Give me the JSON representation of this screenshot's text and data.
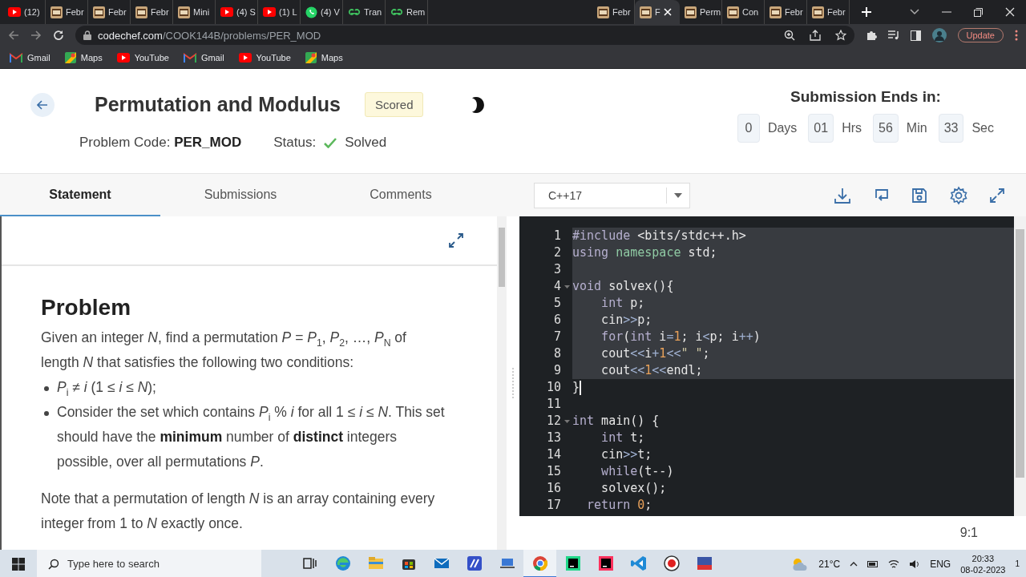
{
  "browser": {
    "tabs": [
      {
        "kind": "youtube",
        "title": "(12)",
        "selected": false
      },
      {
        "kind": "codechef",
        "title": "Febr",
        "selected": false
      },
      {
        "kind": "codechef",
        "title": "Febr",
        "selected": false
      },
      {
        "kind": "codechef",
        "title": "Febr",
        "selected": false
      },
      {
        "kind": "codechef",
        "title": "Mini",
        "selected": false
      },
      {
        "kind": "youtube",
        "title": "(4) S",
        "selected": false
      },
      {
        "kind": "youtube",
        "title": "(1) L",
        "selected": false
      },
      {
        "kind": "whatsapp",
        "title": "(4) V",
        "selected": false
      },
      {
        "kind": "gfg",
        "title": "Tran",
        "selected": false
      },
      {
        "kind": "gfg",
        "title": "Rem",
        "selected": false
      },
      {
        "kind": "codechef",
        "title": "Febr",
        "selected": false
      },
      {
        "kind": "codechef",
        "title": "F",
        "selected": true
      },
      {
        "kind": "codechef",
        "title": "Perm",
        "selected": false
      },
      {
        "kind": "codechef",
        "title": "Con",
        "selected": false
      },
      {
        "kind": "codechef",
        "title": "Febr",
        "selected": false
      },
      {
        "kind": "codechef",
        "title": "Febr",
        "selected": false
      }
    ],
    "url_host": "codechef.com",
    "url_path": "/COOK144B/problems/PER_MOD",
    "update_label": "Update",
    "bookmarks": [
      {
        "kind": "gmail",
        "label": "Gmail"
      },
      {
        "kind": "maps",
        "label": "Maps"
      },
      {
        "kind": "youtube",
        "label": "YouTube"
      },
      {
        "kind": "gmail",
        "label": "Gmail"
      },
      {
        "kind": "youtube",
        "label": "YouTube"
      },
      {
        "kind": "maps",
        "label": "Maps"
      }
    ]
  },
  "problem": {
    "title": "Permutation and Modulus",
    "badge": "Scored",
    "code_label": "Problem Code:",
    "code": "PER_MOD",
    "status_label": "Status:",
    "status": "Solved",
    "solved": true
  },
  "countdown": {
    "title": "Submission Ends in:",
    "units": [
      {
        "value": "0",
        "unit": "Days"
      },
      {
        "value": "01",
        "unit": "Hrs"
      },
      {
        "value": "56",
        "unit": "Min"
      },
      {
        "value": "33",
        "unit": "Sec"
      }
    ]
  },
  "tabs": [
    {
      "label": "Statement",
      "selected": true
    },
    {
      "label": "Submissions",
      "selected": false
    },
    {
      "label": "Comments",
      "selected": false
    }
  ],
  "language": "C++17",
  "statement": {
    "heading": "Problem",
    "blocks": [
      {
        "kind": "para",
        "text": "Given an integer *N*, find a permutation *P* = *P*$_{1}$, *P*$_{2}$, …, *P*$_{N}$ of length *N* that satisfies the following two conditions:"
      },
      {
        "kind": "bullet",
        "text": "*P*$_{i}$ ≠ *i* (1 ≤ *i* ≤ *N*);"
      },
      {
        "kind": "bullet",
        "text": "Consider the set which contains *P*$_{i}$ % *i* for all 1 ≤ *i* ≤ *N*. This set should have the **minimum** number of **distinct** integers possible, over all permutations *P*."
      },
      {
        "kind": "para",
        "text": "Note that a permutation of length *N* is an array containing every integer from 1 to *N* exactly once."
      }
    ]
  },
  "editor": {
    "position": "9:1",
    "lines": [
      {
        "number": "1",
        "kind": "top",
        "selected": true,
        "fold": false,
        "cursor": false,
        "tokens": [
          {
            "kind": "kw",
            "text": "#include"
          },
          {
            "kind": "plain",
            "text": " <bits/stdc++.h>"
          }
        ]
      },
      {
        "number": "2",
        "kind": "top",
        "selected": true,
        "fold": false,
        "cursor": false,
        "tokens": [
          {
            "kind": "kw",
            "text": "using"
          },
          {
            "kind": "ns",
            "text": " namespace"
          },
          {
            "kind": "plain",
            "text": " std;"
          }
        ]
      },
      {
        "number": "3",
        "kind": "top",
        "selected": true,
        "fold": false,
        "cursor": false
      },
      {
        "number": "4",
        "kind": "top",
        "selected": true,
        "fold": true,
        "cursor": false,
        "tokens": [
          {
            "kind": "kw",
            "text": "void"
          },
          {
            "kind": "plain",
            "text": " solvex(){"
          }
        ]
      },
      {
        "number": "5",
        "kind": "block",
        "selected": true,
        "fold": false,
        "cursor": false,
        "tokens": [
          {
            "kind": "kw",
            "text": "int"
          },
          {
            "kind": "plain",
            "text": " p;"
          }
        ]
      },
      {
        "number": "6",
        "kind": "block",
        "selected": true,
        "fold": false,
        "cursor": false,
        "tokens": [
          {
            "kind": "plain",
            "text": "cin"
          },
          {
            "kind": "op",
            "text": ">>"
          },
          {
            "kind": "plain",
            "text": "p;"
          }
        ]
      },
      {
        "number": "7",
        "kind": "block",
        "selected": true,
        "fold": false,
        "cursor": false,
        "tokens": [
          {
            "kind": "kw",
            "text": "for"
          },
          {
            "kind": "plain",
            "text": "("
          },
          {
            "kind": "kw",
            "text": "int"
          },
          {
            "kind": "plain",
            "text": " i"
          },
          {
            "kind": "op",
            "text": "="
          },
          {
            "kind": "num",
            "text": "1"
          },
          {
            "kind": "plain",
            "text": "; i"
          },
          {
            "kind": "op",
            "text": "<"
          },
          {
            "kind": "plain",
            "text": "p; i"
          },
          {
            "kind": "op",
            "text": "++"
          },
          {
            "kind": "plain",
            "text": ")"
          }
        ]
      },
      {
        "number": "8",
        "kind": "block",
        "selected": true,
        "fold": false,
        "cursor": false,
        "tokens": [
          {
            "kind": "plain",
            "text": "cout"
          },
          {
            "kind": "op",
            "text": "<<"
          },
          {
            "kind": "plain",
            "text": "i"
          },
          {
            "kind": "op",
            "text": "+"
          },
          {
            "kind": "num",
            "text": "1"
          },
          {
            "kind": "op",
            "text": "<<"
          },
          {
            "kind": "str",
            "text": "\" \""
          },
          {
            "kind": "plain",
            "text": ";"
          }
        ]
      },
      {
        "number": "9",
        "kind": "block",
        "selected": true,
        "fold": false,
        "cursor": false,
        "tokens": [
          {
            "kind": "plain",
            "text": "cout"
          },
          {
            "kind": "op",
            "text": "<<"
          },
          {
            "kind": "num",
            "text": "1"
          },
          {
            "kind": "op",
            "text": "<<"
          },
          {
            "kind": "plain",
            "text": "endl;"
          }
        ]
      },
      {
        "number": "10",
        "kind": "top",
        "selected": false,
        "fold": false,
        "cursor": true,
        "tokens": [
          {
            "kind": "plain",
            "text": "}"
          }
        ]
      },
      {
        "number": "11",
        "kind": "top",
        "selected": false,
        "fold": false,
        "cursor": false
      },
      {
        "number": "12",
        "kind": "top",
        "selected": false,
        "fold": true,
        "cursor": false,
        "tokens": [
          {
            "kind": "kw",
            "text": "int"
          },
          {
            "kind": "plain",
            "text": " main() {"
          }
        ]
      },
      {
        "number": "13",
        "kind": "block",
        "selected": false,
        "fold": false,
        "cursor": false,
        "tokens": [
          {
            "kind": "kw",
            "text": "int"
          },
          {
            "kind": "plain",
            "text": " t;"
          }
        ]
      },
      {
        "number": "14",
        "kind": "block",
        "selected": false,
        "fold": false,
        "cursor": false,
        "tokens": [
          {
            "kind": "plain",
            "text": "cin"
          },
          {
            "kind": "op",
            "text": ">>"
          },
          {
            "kind": "plain",
            "text": "t;"
          }
        ]
      },
      {
        "number": "15",
        "kind": "block",
        "selected": false,
        "fold": false,
        "cursor": false,
        "tokens": [
          {
            "kind": "kw",
            "text": "while"
          },
          {
            "kind": "plain",
            "text": "(t--)"
          }
        ]
      },
      {
        "number": "16",
        "kind": "block",
        "selected": false,
        "fold": false,
        "cursor": false,
        "tokens": [
          {
            "kind": "plain",
            "text": "solvex();"
          }
        ]
      },
      {
        "number": "17",
        "kind": "half",
        "selected": false,
        "fold": false,
        "cursor": false,
        "tokens": [
          {
            "kind": "kw",
            "text": "return"
          },
          {
            "kind": "num",
            "text": " 0"
          },
          {
            "kind": "plain",
            "text": ";"
          }
        ]
      }
    ]
  },
  "taskbar": {
    "search_placeholder": "Type here to search",
    "apps": [
      {
        "kind": "taskview",
        "selected": false
      },
      {
        "kind": "edge",
        "selected": false
      },
      {
        "kind": "explorer",
        "selected": false
      },
      {
        "kind": "store",
        "selected": false
      },
      {
        "kind": "mail",
        "selected": false
      },
      {
        "kind": "tile",
        "selected": false
      },
      {
        "kind": "laptop",
        "selected": false
      },
      {
        "kind": "chrome",
        "selected": true
      },
      {
        "kind": "pycharm",
        "selected": false
      },
      {
        "kind": "intellij",
        "selected": false
      },
      {
        "kind": "vscode",
        "selected": false
      },
      {
        "kind": "record",
        "selected": false
      },
      {
        "kind": "devcpp",
        "selected": false
      }
    ],
    "temperature": "21°C",
    "language": "ENG",
    "time": "20:33",
    "date": "08-02-2023",
    "notifications": "1"
  }
}
